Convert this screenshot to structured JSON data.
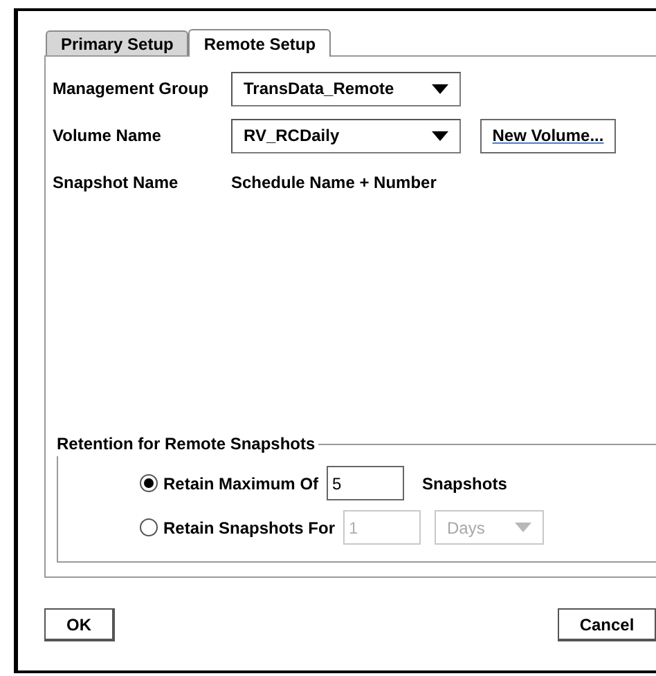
{
  "tabs": [
    {
      "label": "Primary Setup",
      "selected": false
    },
    {
      "label": "Remote Setup",
      "selected": true
    }
  ],
  "management_group": {
    "label": "Management Group",
    "value": "TransData_Remote"
  },
  "volume_name": {
    "label": "Volume Name",
    "value": "RV_RCDaily",
    "button": "New Volume..."
  },
  "snapshot_name": {
    "label": "Snapshot Name",
    "value": "Schedule Name + Number"
  },
  "retention": {
    "title": "Retention for Remote Snapshots",
    "options": [
      {
        "label": "Retain Maximum Of",
        "selected": true,
        "value": "5",
        "disabled": false,
        "kind": "text",
        "unit": "Snapshots"
      },
      {
        "label": "Retain Snapshots For",
        "selected": false,
        "value": "1",
        "disabled": true,
        "kind": "dropdown",
        "unit": "Days"
      }
    ]
  },
  "buttons": [
    "OK",
    "Cancel"
  ]
}
